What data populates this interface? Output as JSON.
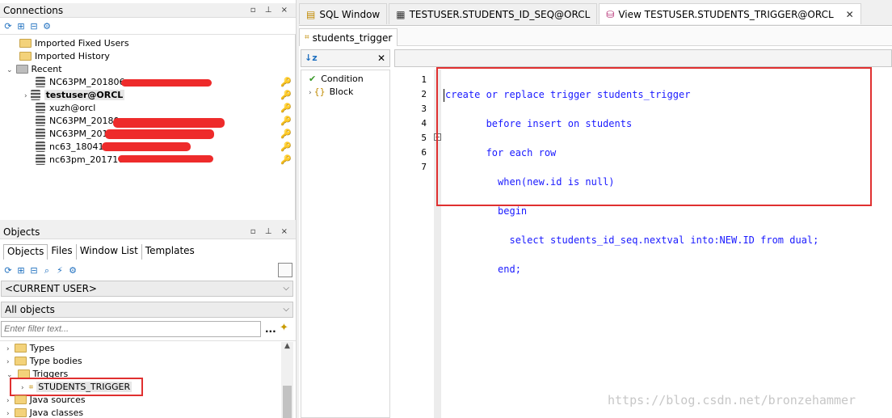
{
  "connections_panel": {
    "title": "Connections",
    "controls": "▫ ⊥ ×",
    "items": [
      {
        "label": "Imported Fixed Users"
      },
      {
        "label": "Imported History"
      },
      {
        "label": "Recent"
      },
      {
        "label": "NC63PM_201806"
      },
      {
        "label": "testuser@ORCL"
      },
      {
        "label": "xuzh@orcl"
      },
      {
        "label": "NC63PM_20180"
      },
      {
        "label": "NC63PM_2018"
      },
      {
        "label": "nc63_18041"
      },
      {
        "label": "nc63pm_201710"
      }
    ]
  },
  "objects_panel": {
    "title": "Objects",
    "controls": "▫ ⊥ ×",
    "tabs": [
      "Objects",
      "Files",
      "Window List",
      "Templates"
    ],
    "user_select": "<CURRENT USER>",
    "type_select": "All objects",
    "filter_placeholder": "Enter filter text...",
    "filter_more": "...",
    "tree": [
      {
        "label": "Types"
      },
      {
        "label": "Type bodies"
      },
      {
        "label": "Triggers"
      },
      {
        "label": "STUDENTS_TRIGGER"
      },
      {
        "label": "Java sources"
      },
      {
        "label": "Java classes"
      }
    ]
  },
  "editor_tabs": [
    {
      "label": "SQL Window"
    },
    {
      "label": "TESTUSER.STUDENTS_ID_SEQ@ORCL"
    },
    {
      "label": "View TESTUSER.STUDENTS_TRIGGER@ORCL",
      "close": "✕"
    }
  ],
  "sub_tab": {
    "label": "students_trigger"
  },
  "structure": {
    "sort_icon": "↓z",
    "close": "✕",
    "items": [
      {
        "label": "Condition"
      },
      {
        "label": "Block"
      }
    ]
  },
  "code_lines": [
    "create or replace trigger students_trigger",
    "       before insert on students",
    "       for each row",
    "         when(new.id is null)",
    "         begin",
    "           select students_id_seq.nextval into:NEW.ID from dual;",
    "         end;"
  ],
  "line_numbers": [
    "1",
    "2",
    "3",
    "4",
    "5",
    "6",
    "7"
  ],
  "watermark": "https://blog.csdn.net/bronzehammer"
}
